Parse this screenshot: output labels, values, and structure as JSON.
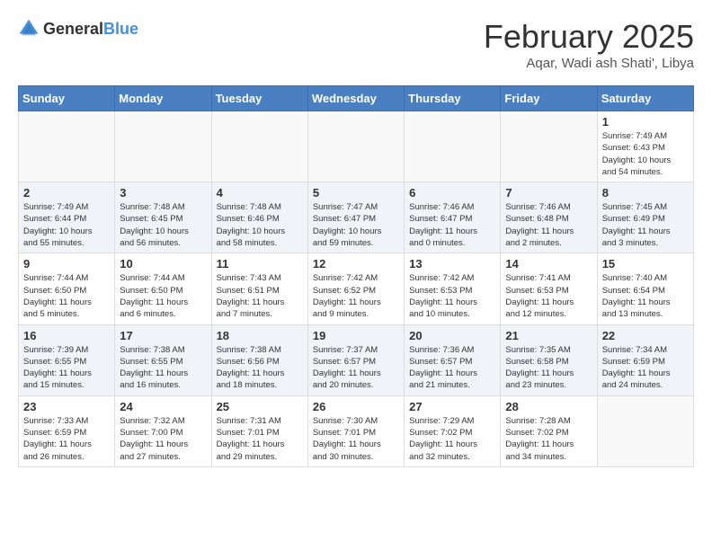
{
  "logo": {
    "general": "General",
    "blue": "Blue"
  },
  "title": "February 2025",
  "location": "Aqar, Wadi ash Shati', Libya",
  "days_of_week": [
    "Sunday",
    "Monday",
    "Tuesday",
    "Wednesday",
    "Thursday",
    "Friday",
    "Saturday"
  ],
  "weeks": [
    [
      {
        "day": "",
        "info": ""
      },
      {
        "day": "",
        "info": ""
      },
      {
        "day": "",
        "info": ""
      },
      {
        "day": "",
        "info": ""
      },
      {
        "day": "",
        "info": ""
      },
      {
        "day": "",
        "info": ""
      },
      {
        "day": "1",
        "info": "Sunrise: 7:49 AM\nSunset: 6:43 PM\nDaylight: 10 hours\nand 54 minutes."
      }
    ],
    [
      {
        "day": "2",
        "info": "Sunrise: 7:49 AM\nSunset: 6:44 PM\nDaylight: 10 hours\nand 55 minutes."
      },
      {
        "day": "3",
        "info": "Sunrise: 7:48 AM\nSunset: 6:45 PM\nDaylight: 10 hours\nand 56 minutes."
      },
      {
        "day": "4",
        "info": "Sunrise: 7:48 AM\nSunset: 6:46 PM\nDaylight: 10 hours\nand 58 minutes."
      },
      {
        "day": "5",
        "info": "Sunrise: 7:47 AM\nSunset: 6:47 PM\nDaylight: 10 hours\nand 59 minutes."
      },
      {
        "day": "6",
        "info": "Sunrise: 7:46 AM\nSunset: 6:47 PM\nDaylight: 11 hours\nand 0 minutes."
      },
      {
        "day": "7",
        "info": "Sunrise: 7:46 AM\nSunset: 6:48 PM\nDaylight: 11 hours\nand 2 minutes."
      },
      {
        "day": "8",
        "info": "Sunrise: 7:45 AM\nSunset: 6:49 PM\nDaylight: 11 hours\nand 3 minutes."
      }
    ],
    [
      {
        "day": "9",
        "info": "Sunrise: 7:44 AM\nSunset: 6:50 PM\nDaylight: 11 hours\nand 5 minutes."
      },
      {
        "day": "10",
        "info": "Sunrise: 7:44 AM\nSunset: 6:50 PM\nDaylight: 11 hours\nand 6 minutes."
      },
      {
        "day": "11",
        "info": "Sunrise: 7:43 AM\nSunset: 6:51 PM\nDaylight: 11 hours\nand 7 minutes."
      },
      {
        "day": "12",
        "info": "Sunrise: 7:42 AM\nSunset: 6:52 PM\nDaylight: 11 hours\nand 9 minutes."
      },
      {
        "day": "13",
        "info": "Sunrise: 7:42 AM\nSunset: 6:53 PM\nDaylight: 11 hours\nand 10 minutes."
      },
      {
        "day": "14",
        "info": "Sunrise: 7:41 AM\nSunset: 6:53 PM\nDaylight: 11 hours\nand 12 minutes."
      },
      {
        "day": "15",
        "info": "Sunrise: 7:40 AM\nSunset: 6:54 PM\nDaylight: 11 hours\nand 13 minutes."
      }
    ],
    [
      {
        "day": "16",
        "info": "Sunrise: 7:39 AM\nSunset: 6:55 PM\nDaylight: 11 hours\nand 15 minutes."
      },
      {
        "day": "17",
        "info": "Sunrise: 7:38 AM\nSunset: 6:55 PM\nDaylight: 11 hours\nand 16 minutes."
      },
      {
        "day": "18",
        "info": "Sunrise: 7:38 AM\nSunset: 6:56 PM\nDaylight: 11 hours\nand 18 minutes."
      },
      {
        "day": "19",
        "info": "Sunrise: 7:37 AM\nSunset: 6:57 PM\nDaylight: 11 hours\nand 20 minutes."
      },
      {
        "day": "20",
        "info": "Sunrise: 7:36 AM\nSunset: 6:57 PM\nDaylight: 11 hours\nand 21 minutes."
      },
      {
        "day": "21",
        "info": "Sunrise: 7:35 AM\nSunset: 6:58 PM\nDaylight: 11 hours\nand 23 minutes."
      },
      {
        "day": "22",
        "info": "Sunrise: 7:34 AM\nSunset: 6:59 PM\nDaylight: 11 hours\nand 24 minutes."
      }
    ],
    [
      {
        "day": "23",
        "info": "Sunrise: 7:33 AM\nSunset: 6:59 PM\nDaylight: 11 hours\nand 26 minutes."
      },
      {
        "day": "24",
        "info": "Sunrise: 7:32 AM\nSunset: 7:00 PM\nDaylight: 11 hours\nand 27 minutes."
      },
      {
        "day": "25",
        "info": "Sunrise: 7:31 AM\nSunset: 7:01 PM\nDaylight: 11 hours\nand 29 minutes."
      },
      {
        "day": "26",
        "info": "Sunrise: 7:30 AM\nSunset: 7:01 PM\nDaylight: 11 hours\nand 30 minutes."
      },
      {
        "day": "27",
        "info": "Sunrise: 7:29 AM\nSunset: 7:02 PM\nDaylight: 11 hours\nand 32 minutes."
      },
      {
        "day": "28",
        "info": "Sunrise: 7:28 AM\nSunset: 7:02 PM\nDaylight: 11 hours\nand 34 minutes."
      },
      {
        "day": "",
        "info": ""
      }
    ]
  ]
}
